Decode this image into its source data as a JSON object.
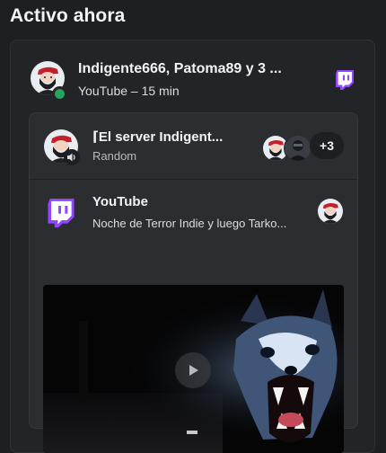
{
  "heading": "Activo ahora",
  "activity": {
    "title": "Indigente666, Patoma89 y 3 ...",
    "subtitle": "YouTube – 15 min",
    "platform_icon": "twitch-icon",
    "status_color": "#23a55a"
  },
  "server": {
    "title": "⌈El server Indigent...",
    "subtitle": "Random",
    "extra_members": "+3"
  },
  "stream": {
    "title": "YouTube",
    "subtitle": "Noche de Terror Indie y luego Tarko...",
    "platform_color": "#9146ff"
  },
  "colors": {
    "accent_purple": "#9146ff",
    "online_green": "#23a55a"
  }
}
